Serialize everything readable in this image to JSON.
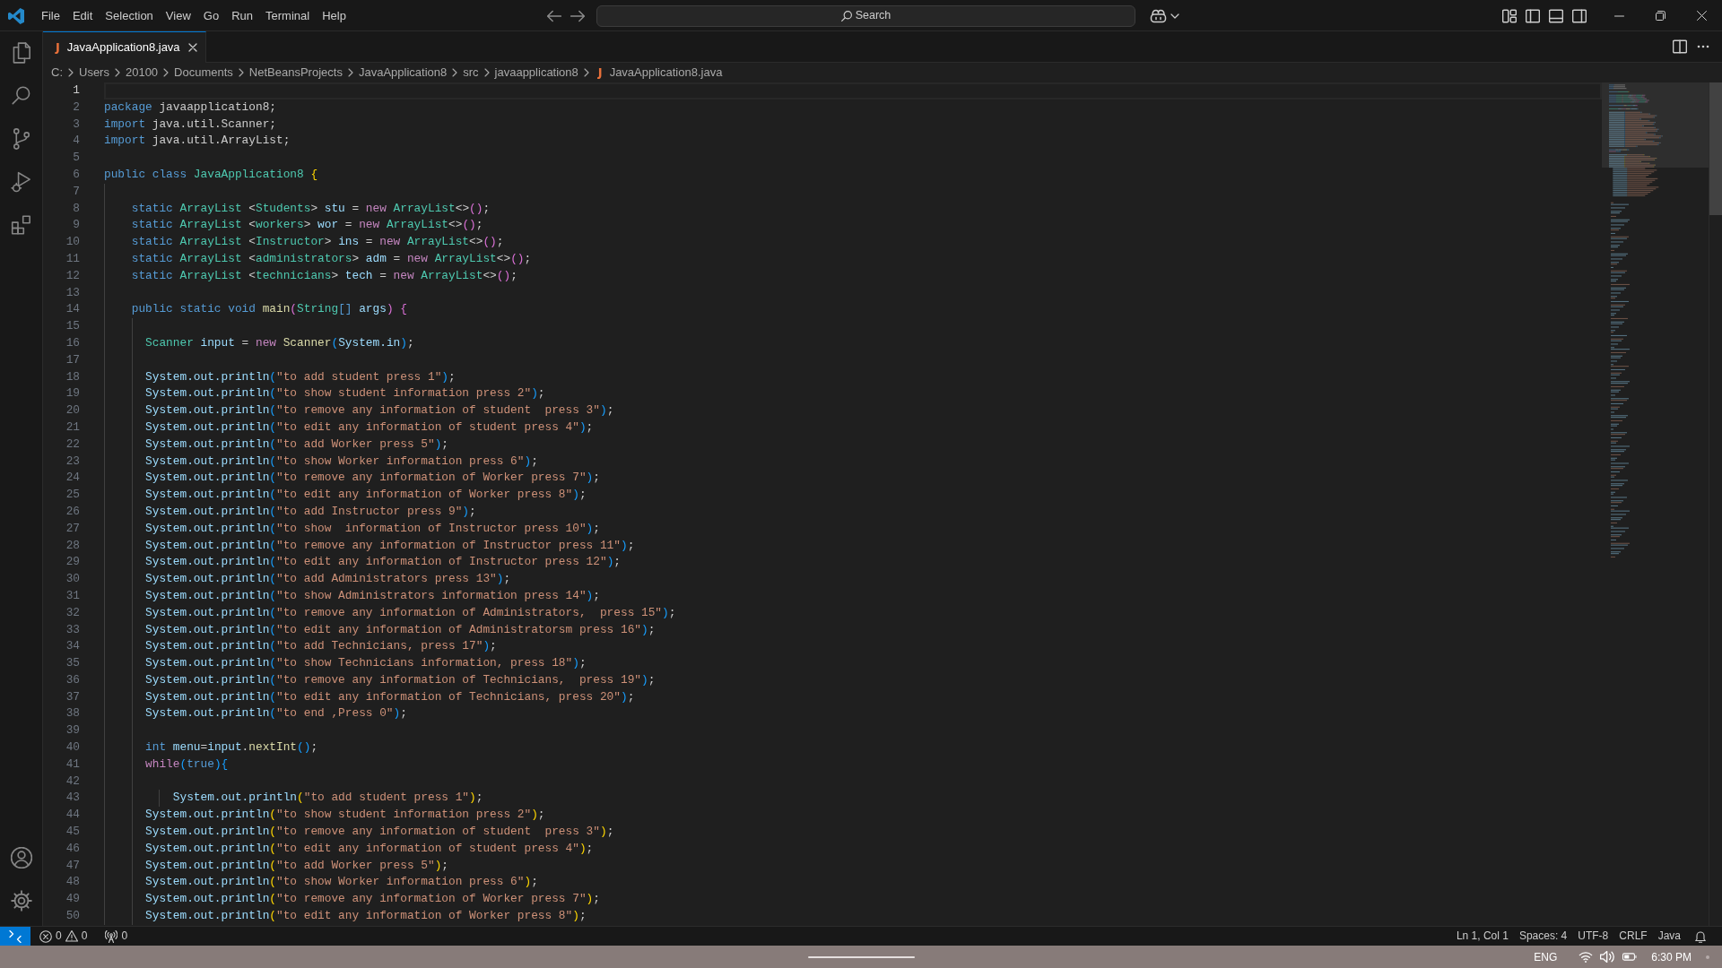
{
  "title_bar": {
    "menu": [
      "File",
      "Edit",
      "Selection",
      "View",
      "Go",
      "Run",
      "Terminal",
      "Help"
    ],
    "command_center": {
      "label": "Search"
    }
  },
  "tabs": [
    {
      "icon": "J",
      "label": "JavaApplication8.java",
      "selected": true
    }
  ],
  "breadcrumb": [
    {
      "label": "C:"
    },
    {
      "label": "Users"
    },
    {
      "label": "20100"
    },
    {
      "label": "Documents"
    },
    {
      "label": "NetBeansProjects"
    },
    {
      "label": "JavaApplication8"
    },
    {
      "label": "src"
    },
    {
      "label": "javaapplication8"
    },
    {
      "icon": "J",
      "label": "JavaApplication8.java"
    }
  ],
  "editor": {
    "lines": [
      {
        "number": "1",
        "current": true
      },
      {
        "number": "2",
        "current": false,
        "tokens": [
          {
            "text": "package ",
            "kind": "keyword"
          },
          {
            "text": "javaapplication8;",
            "kind": "plain"
          }
        ]
      },
      {
        "number": "3",
        "current": false,
        "tokens": [
          {
            "text": "import ",
            "kind": "keyword"
          },
          {
            "text": "java.util.Scanner;",
            "kind": "plain"
          }
        ]
      },
      {
        "number": "4",
        "current": false,
        "tokens": [
          {
            "text": "import ",
            "kind": "keyword"
          },
          {
            "text": "java.util.ArrayList;",
            "kind": "plain"
          }
        ]
      },
      {
        "number": "5",
        "current": false
      },
      {
        "number": "6",
        "current": false,
        "tokens": [
          {
            "text": "public class ",
            "kind": "keyword"
          },
          {
            "text": "JavaApplication8 ",
            "kind": "type"
          },
          {
            "text": "{",
            "kind": "bracket1"
          }
        ]
      },
      {
        "number": "7",
        "current": false
      },
      {
        "number": "8",
        "current": false,
        "tokens": [
          {
            "text": "    static ",
            "kind": "keyword"
          },
          {
            "text": "ArrayList",
            "kind": "type"
          },
          {
            "text": " <",
            "kind": "plain"
          },
          {
            "text": "Students",
            "kind": "type"
          },
          {
            "text": "> ",
            "kind": "plain"
          },
          {
            "text": "stu",
            "kind": "variable"
          },
          {
            "text": " = ",
            "kind": "plain"
          },
          {
            "text": "new ",
            "kind": "control"
          },
          {
            "text": "ArrayList",
            "kind": "type"
          },
          {
            "text": "<>",
            "kind": "plain"
          },
          {
            "text": "()",
            "kind": "bracket2"
          },
          {
            "text": ";",
            "kind": "plain"
          }
        ]
      },
      {
        "number": "9",
        "current": false,
        "tokens": [
          {
            "text": "    static ",
            "kind": "keyword"
          },
          {
            "text": "ArrayList",
            "kind": "type"
          },
          {
            "text": " <",
            "kind": "plain"
          },
          {
            "text": "workers",
            "kind": "type"
          },
          {
            "text": "> ",
            "kind": "plain"
          },
          {
            "text": "wor",
            "kind": "variable"
          },
          {
            "text": " = ",
            "kind": "plain"
          },
          {
            "text": "new ",
            "kind": "control"
          },
          {
            "text": "ArrayList",
            "kind": "type"
          },
          {
            "text": "<>",
            "kind": "plain"
          },
          {
            "text": "()",
            "kind": "bracket2"
          },
          {
            "text": ";",
            "kind": "plain"
          }
        ]
      },
      {
        "number": "10",
        "current": false,
        "tokens": [
          {
            "text": "    static ",
            "kind": "keyword"
          },
          {
            "text": "ArrayList",
            "kind": "type"
          },
          {
            "text": " <",
            "kind": "plain"
          },
          {
            "text": "Instructor",
            "kind": "type"
          },
          {
            "text": "> ",
            "kind": "plain"
          },
          {
            "text": "ins",
            "kind": "variable"
          },
          {
            "text": " = ",
            "kind": "plain"
          },
          {
            "text": "new ",
            "kind": "control"
          },
          {
            "text": "ArrayList",
            "kind": "type"
          },
          {
            "text": "<>",
            "kind": "plain"
          },
          {
            "text": "()",
            "kind": "bracket2"
          },
          {
            "text": ";",
            "kind": "plain"
          }
        ]
      },
      {
        "number": "11",
        "current": false,
        "tokens": [
          {
            "text": "    static ",
            "kind": "keyword"
          },
          {
            "text": "ArrayList",
            "kind": "type"
          },
          {
            "text": " <",
            "kind": "plain"
          },
          {
            "text": "administrators",
            "kind": "type"
          },
          {
            "text": "> ",
            "kind": "plain"
          },
          {
            "text": "adm",
            "kind": "variable"
          },
          {
            "text": " = ",
            "kind": "plain"
          },
          {
            "text": "new ",
            "kind": "control"
          },
          {
            "text": "ArrayList",
            "kind": "type"
          },
          {
            "text": "<>",
            "kind": "plain"
          },
          {
            "text": "()",
            "kind": "bracket2"
          },
          {
            "text": ";",
            "kind": "plain"
          }
        ]
      },
      {
        "number": "12",
        "current": false,
        "tokens": [
          {
            "text": "    static ",
            "kind": "keyword"
          },
          {
            "text": "ArrayList",
            "kind": "type"
          },
          {
            "text": " <",
            "kind": "plain"
          },
          {
            "text": "technicians",
            "kind": "type"
          },
          {
            "text": "> ",
            "kind": "plain"
          },
          {
            "text": "tech",
            "kind": "variable"
          },
          {
            "text": " = ",
            "kind": "plain"
          },
          {
            "text": "new ",
            "kind": "control"
          },
          {
            "text": "ArrayList",
            "kind": "type"
          },
          {
            "text": "<>",
            "kind": "plain"
          },
          {
            "text": "()",
            "kind": "bracket2"
          },
          {
            "text": ";",
            "kind": "plain"
          }
        ]
      },
      {
        "number": "13",
        "current": false
      },
      {
        "number": "14",
        "current": false,
        "tokens": [
          {
            "text": "    public static void ",
            "kind": "keyword"
          },
          {
            "text": "main",
            "kind": "function"
          },
          {
            "text": "(",
            "kind": "bracket2"
          },
          {
            "text": "String",
            "kind": "type"
          },
          {
            "text": "[] ",
            "kind": "keyword"
          },
          {
            "text": "args",
            "kind": "variable"
          },
          {
            "text": ") {",
            "kind": "bracket2"
          }
        ]
      },
      {
        "number": "15",
        "current": false
      },
      {
        "number": "16",
        "current": false,
        "tokens": [
          {
            "text": "      Scanner ",
            "kind": "type"
          },
          {
            "text": "input",
            "kind": "variable"
          },
          {
            "text": " = ",
            "kind": "plain"
          },
          {
            "text": "new ",
            "kind": "control"
          },
          {
            "text": "Scanner",
            "kind": "function"
          },
          {
            "text": "(",
            "kind": "bracket3"
          },
          {
            "text": "System.in",
            "kind": "variable"
          },
          {
            "text": ")",
            "kind": "bracket3"
          },
          {
            "text": ";",
            "kind": "plain"
          }
        ]
      },
      {
        "number": "17",
        "current": false
      },
      {
        "number": "18",
        "current": false,
        "tokens": [
          {
            "text": "      System.out.println",
            "kind": "variable"
          },
          {
            "text": "(",
            "kind": "bracket3"
          },
          {
            "text": "\"to add student press 1\"",
            "kind": "string"
          },
          {
            "text": ")",
            "kind": "bracket3"
          },
          {
            "text": ";",
            "kind": "plain"
          }
        ]
      },
      {
        "number": "19",
        "current": false,
        "tokens": [
          {
            "text": "      System.out.println",
            "kind": "variable"
          },
          {
            "text": "(",
            "kind": "bracket3"
          },
          {
            "text": "\"to show student information press 2\"",
            "kind": "string"
          },
          {
            "text": ")",
            "kind": "bracket3"
          },
          {
            "text": ";",
            "kind": "plain"
          }
        ]
      },
      {
        "number": "20",
        "current": false,
        "tokens": [
          {
            "text": "      System.out.println",
            "kind": "variable"
          },
          {
            "text": "(",
            "kind": "bracket3"
          },
          {
            "text": "\"to remove any information of student  press 3\"",
            "kind": "string"
          },
          {
            "text": ")",
            "kind": "bracket3"
          },
          {
            "text": ";",
            "kind": "plain"
          }
        ]
      },
      {
        "number": "21",
        "current": false,
        "tokens": [
          {
            "text": "      System.out.println",
            "kind": "variable"
          },
          {
            "text": "(",
            "kind": "bracket3"
          },
          {
            "text": "\"to edit any information of student press 4\"",
            "kind": "string"
          },
          {
            "text": ")",
            "kind": "bracket3"
          },
          {
            "text": ";",
            "kind": "plain"
          }
        ]
      },
      {
        "number": "22",
        "current": false,
        "tokens": [
          {
            "text": "      System.out.println",
            "kind": "variable"
          },
          {
            "text": "(",
            "kind": "bracket3"
          },
          {
            "text": "\"to add Worker press 5\"",
            "kind": "string"
          },
          {
            "text": ")",
            "kind": "bracket3"
          },
          {
            "text": ";",
            "kind": "plain"
          }
        ]
      },
      {
        "number": "23",
        "current": false,
        "tokens": [
          {
            "text": "      System.out.println",
            "kind": "variable"
          },
          {
            "text": "(",
            "kind": "bracket3"
          },
          {
            "text": "\"to show Worker information press 6\"",
            "kind": "string"
          },
          {
            "text": ")",
            "kind": "bracket3"
          },
          {
            "text": ";",
            "kind": "plain"
          }
        ]
      },
      {
        "number": "24",
        "current": false,
        "tokens": [
          {
            "text": "      System.out.println",
            "kind": "variable"
          },
          {
            "text": "(",
            "kind": "bracket3"
          },
          {
            "text": "\"to remove any information of Worker press 7\"",
            "kind": "string"
          },
          {
            "text": ")",
            "kind": "bracket3"
          },
          {
            "text": ";",
            "kind": "plain"
          }
        ]
      },
      {
        "number": "25",
        "current": false,
        "tokens": [
          {
            "text": "      System.out.println",
            "kind": "variable"
          },
          {
            "text": "(",
            "kind": "bracket3"
          },
          {
            "text": "\"to edit any information of Worker press 8\"",
            "kind": "string"
          },
          {
            "text": ")",
            "kind": "bracket3"
          },
          {
            "text": ";",
            "kind": "plain"
          }
        ]
      },
      {
        "number": "26",
        "current": false,
        "tokens": [
          {
            "text": "      System.out.println",
            "kind": "variable"
          },
          {
            "text": "(",
            "kind": "bracket3"
          },
          {
            "text": "\"to add Instructor press 9\"",
            "kind": "string"
          },
          {
            "text": ")",
            "kind": "bracket3"
          },
          {
            "text": ";",
            "kind": "plain"
          }
        ]
      },
      {
        "number": "27",
        "current": false,
        "tokens": [
          {
            "text": "      System.out.println",
            "kind": "variable"
          },
          {
            "text": "(",
            "kind": "bracket3"
          },
          {
            "text": "\"to show  information of Instructor press 10\"",
            "kind": "string"
          },
          {
            "text": ")",
            "kind": "bracket3"
          },
          {
            "text": ";",
            "kind": "plain"
          }
        ]
      },
      {
        "number": "28",
        "current": false,
        "tokens": [
          {
            "text": "      System.out.println",
            "kind": "variable"
          },
          {
            "text": "(",
            "kind": "bracket3"
          },
          {
            "text": "\"to remove any information of Instructor press 11\"",
            "kind": "string"
          },
          {
            "text": ")",
            "kind": "bracket3"
          },
          {
            "text": ";",
            "kind": "plain"
          }
        ]
      },
      {
        "number": "29",
        "current": false,
        "tokens": [
          {
            "text": "      System.out.println",
            "kind": "variable"
          },
          {
            "text": "(",
            "kind": "bracket3"
          },
          {
            "text": "\"to edit any information of Instructor press 12\"",
            "kind": "string"
          },
          {
            "text": ")",
            "kind": "bracket3"
          },
          {
            "text": ";",
            "kind": "plain"
          }
        ]
      },
      {
        "number": "30",
        "current": false,
        "tokens": [
          {
            "text": "      System.out.println",
            "kind": "variable"
          },
          {
            "text": "(",
            "kind": "bracket3"
          },
          {
            "text": "\"to add Administrators press 13\"",
            "kind": "string"
          },
          {
            "text": ")",
            "kind": "bracket3"
          },
          {
            "text": ";",
            "kind": "plain"
          }
        ]
      },
      {
        "number": "31",
        "current": false,
        "tokens": [
          {
            "text": "      System.out.println",
            "kind": "variable"
          },
          {
            "text": "(",
            "kind": "bracket3"
          },
          {
            "text": "\"to show Administrators information press 14\"",
            "kind": "string"
          },
          {
            "text": ")",
            "kind": "bracket3"
          },
          {
            "text": ";",
            "kind": "plain"
          }
        ]
      },
      {
        "number": "32",
        "current": false,
        "tokens": [
          {
            "text": "      System.out.println",
            "kind": "variable"
          },
          {
            "text": "(",
            "kind": "bracket3"
          },
          {
            "text": "\"to remove any information of Administrators,  press 15\"",
            "kind": "string"
          },
          {
            "text": ")",
            "kind": "bracket3"
          },
          {
            "text": ";",
            "kind": "plain"
          }
        ]
      },
      {
        "number": "33",
        "current": false,
        "tokens": [
          {
            "text": "      System.out.println",
            "kind": "variable"
          },
          {
            "text": "(",
            "kind": "bracket3"
          },
          {
            "text": "\"to edit any information of Administratorsm press 16\"",
            "kind": "string"
          },
          {
            "text": ")",
            "kind": "bracket3"
          },
          {
            "text": ";",
            "kind": "plain"
          }
        ]
      },
      {
        "number": "34",
        "current": false,
        "tokens": [
          {
            "text": "      System.out.println",
            "kind": "variable"
          },
          {
            "text": "(",
            "kind": "bracket3"
          },
          {
            "text": "\"to add Technicians, press 17\"",
            "kind": "string"
          },
          {
            "text": ")",
            "kind": "bracket3"
          },
          {
            "text": ";",
            "kind": "plain"
          }
        ]
      },
      {
        "number": "35",
        "current": false,
        "tokens": [
          {
            "text": "      System.out.println",
            "kind": "variable"
          },
          {
            "text": "(",
            "kind": "bracket3"
          },
          {
            "text": "\"to show Technicians information, press 18\"",
            "kind": "string"
          },
          {
            "text": ")",
            "kind": "bracket3"
          },
          {
            "text": ";",
            "kind": "plain"
          }
        ]
      },
      {
        "number": "36",
        "current": false,
        "tokens": [
          {
            "text": "      System.out.println",
            "kind": "variable"
          },
          {
            "text": "(",
            "kind": "bracket3"
          },
          {
            "text": "\"to remove any information of Technicians,  press 19\"",
            "kind": "string"
          },
          {
            "text": ")",
            "kind": "bracket3"
          },
          {
            "text": ";",
            "kind": "plain"
          }
        ]
      },
      {
        "number": "37",
        "current": false,
        "tokens": [
          {
            "text": "      System.out.println",
            "kind": "variable"
          },
          {
            "text": "(",
            "kind": "bracket3"
          },
          {
            "text": "\"to edit any information of Technicians, press 20\"",
            "kind": "string"
          },
          {
            "text": ")",
            "kind": "bracket3"
          },
          {
            "text": ";",
            "kind": "plain"
          }
        ]
      },
      {
        "number": "38",
        "current": false,
        "tokens": [
          {
            "text": "      System.out.println",
            "kind": "variable"
          },
          {
            "text": "(",
            "kind": "bracket3"
          },
          {
            "text": "\"to end ,Press 0\"",
            "kind": "string"
          },
          {
            "text": ")",
            "kind": "bracket3"
          },
          {
            "text": ";",
            "kind": "plain"
          }
        ]
      },
      {
        "number": "39",
        "current": false
      },
      {
        "number": "40",
        "current": false,
        "tokens": [
          {
            "text": "      int ",
            "kind": "keyword"
          },
          {
            "text": "menu",
            "kind": "variable"
          },
          {
            "text": "=",
            "kind": "plain"
          },
          {
            "text": "input",
            "kind": "variable"
          },
          {
            "text": ".",
            "kind": "plain"
          },
          {
            "text": "nextInt",
            "kind": "function"
          },
          {
            "text": "()",
            "kind": "bracket3"
          },
          {
            "text": ";",
            "kind": "plain"
          }
        ]
      },
      {
        "number": "41",
        "current": false,
        "tokens": [
          {
            "text": "      while",
            "kind": "control"
          },
          {
            "text": "(",
            "kind": "bracket3"
          },
          {
            "text": "true",
            "kind": "keyword"
          },
          {
            "text": "){",
            "kind": "bracket3"
          }
        ]
      },
      {
        "number": "42",
        "current": false
      },
      {
        "number": "43",
        "current": false,
        "tokens": [
          {
            "text": "          System.out.println",
            "kind": "variable"
          },
          {
            "text": "(",
            "kind": "bracket1"
          },
          {
            "text": "\"to add student press 1\"",
            "kind": "string"
          },
          {
            "text": ")",
            "kind": "bracket1"
          },
          {
            "text": ";",
            "kind": "plain"
          }
        ]
      },
      {
        "number": "44",
        "current": false,
        "tokens": [
          {
            "text": "      System.out.println",
            "kind": "variable"
          },
          {
            "text": "(",
            "kind": "bracket1"
          },
          {
            "text": "\"to show student information press 2\"",
            "kind": "string"
          },
          {
            "text": ")",
            "kind": "bracket1"
          },
          {
            "text": ";",
            "kind": "plain"
          }
        ]
      },
      {
        "number": "45",
        "current": false,
        "tokens": [
          {
            "text": "      System.out.println",
            "kind": "variable"
          },
          {
            "text": "(",
            "kind": "bracket1"
          },
          {
            "text": "\"to remove any information of student  press 3\"",
            "kind": "string"
          },
          {
            "text": ")",
            "kind": "bracket1"
          },
          {
            "text": ";",
            "kind": "plain"
          }
        ]
      },
      {
        "number": "46",
        "current": false,
        "tokens": [
          {
            "text": "      System.out.println",
            "kind": "variable"
          },
          {
            "text": "(",
            "kind": "bracket1"
          },
          {
            "text": "\"to edit any information of student press 4\"",
            "kind": "string"
          },
          {
            "text": ")",
            "kind": "bracket1"
          },
          {
            "text": ";",
            "kind": "plain"
          }
        ]
      },
      {
        "number": "47",
        "current": false,
        "tokens": [
          {
            "text": "      System.out.println",
            "kind": "variable"
          },
          {
            "text": "(",
            "kind": "bracket1"
          },
          {
            "text": "\"to add Worker press 5\"",
            "kind": "string"
          },
          {
            "text": ")",
            "kind": "bracket1"
          },
          {
            "text": ";",
            "kind": "plain"
          }
        ]
      },
      {
        "number": "48",
        "current": false,
        "tokens": [
          {
            "text": "      System.out.println",
            "kind": "variable"
          },
          {
            "text": "(",
            "kind": "bracket1"
          },
          {
            "text": "\"to show Worker information press 6\"",
            "kind": "string"
          },
          {
            "text": ")",
            "kind": "bracket1"
          },
          {
            "text": ";",
            "kind": "plain"
          }
        ]
      },
      {
        "number": "49",
        "current": false,
        "tokens": [
          {
            "text": "      System.out.println",
            "kind": "variable"
          },
          {
            "text": "(",
            "kind": "bracket1"
          },
          {
            "text": "\"to remove any information of Worker press 7\"",
            "kind": "string"
          },
          {
            "text": ")",
            "kind": "bracket1"
          },
          {
            "text": ";",
            "kind": "plain"
          }
        ]
      },
      {
        "number": "50",
        "current": false,
        "tokens": [
          {
            "text": "      System.out.println",
            "kind": "variable"
          },
          {
            "text": "(",
            "kind": "bracket1"
          },
          {
            "text": "\"to edit any information of Worker press 8\"",
            "kind": "string"
          },
          {
            "text": ")",
            "kind": "bracket1"
          },
          {
            "text": ";",
            "kind": "plain"
          }
        ]
      }
    ]
  },
  "status_bar": {
    "errors": "0",
    "warnings": "0",
    "ports": "0",
    "items": [
      "Ln 1, Col 1",
      "Spaces: 4",
      "UTF-8",
      "CRLF",
      "Java"
    ]
  },
  "taskbar": {
    "language": "ENG",
    "time": "6:30 PM"
  }
}
